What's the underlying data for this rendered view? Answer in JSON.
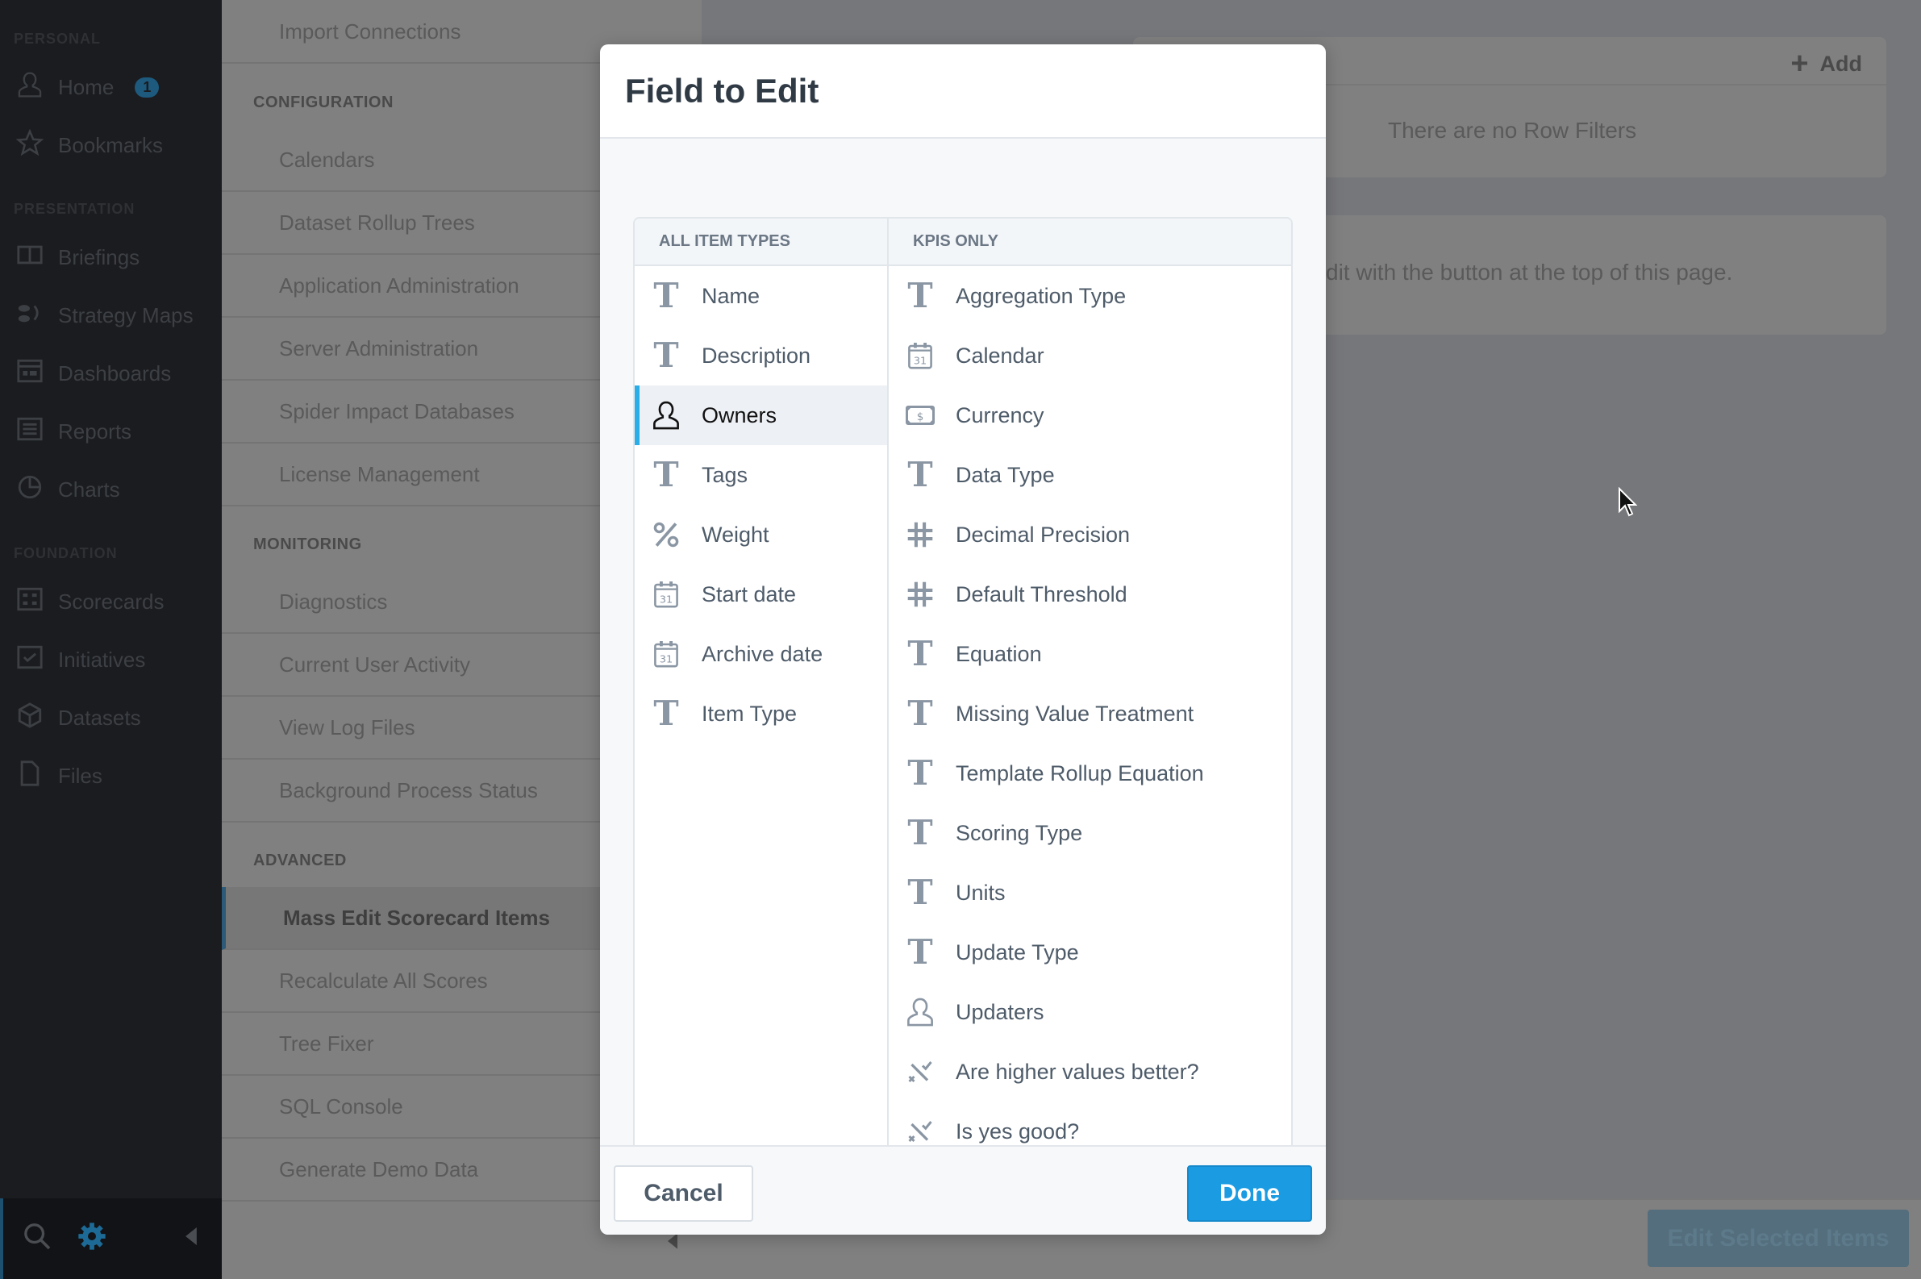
{
  "sidebar": {
    "sections": [
      {
        "label": "PERSONAL",
        "items": [
          {
            "label": "Home",
            "icon": "person-icon",
            "badge": "1"
          },
          {
            "label": "Bookmarks",
            "icon": "star-icon"
          }
        ]
      },
      {
        "label": "PRESENTATION",
        "items": [
          {
            "label": "Briefings",
            "icon": "book-icon"
          },
          {
            "label": "Strategy Maps",
            "icon": "strategy-map-icon"
          },
          {
            "label": "Dashboards",
            "icon": "dashboard-icon"
          },
          {
            "label": "Reports",
            "icon": "report-icon"
          },
          {
            "label": "Charts",
            "icon": "pie-chart-icon"
          }
        ]
      },
      {
        "label": "FOUNDATION",
        "items": [
          {
            "label": "Scorecards",
            "icon": "scorecard-icon"
          },
          {
            "label": "Initiatives",
            "icon": "checkbox-icon"
          },
          {
            "label": "Datasets",
            "icon": "cube-icon"
          },
          {
            "label": "Files",
            "icon": "file-icon"
          }
        ]
      }
    ],
    "accent": "#1d5a7e"
  },
  "nav": {
    "top_item": "Import Connections",
    "sections": [
      {
        "label": "CONFIGURATION",
        "items": [
          "Calendars",
          "Dataset Rollup Trees",
          "Application Administration",
          "Server Administration",
          "Spider Impact Databases",
          "License Management"
        ]
      },
      {
        "label": "MONITORING",
        "items": [
          "Diagnostics",
          "Current User Activity",
          "View Log Files",
          "Background Process Status"
        ]
      },
      {
        "label": "ADVANCED",
        "items": [
          "Mass Edit Scorecard Items",
          "Recalculate All Scores",
          "Tree Fixer",
          "SQL Console",
          "Generate Demo Data"
        ]
      }
    ],
    "active": "Mass Edit Scorecard Items"
  },
  "main": {
    "add_label": "Add",
    "row_filters_empty": "There are no Row Filters",
    "hint_text": "dit with the button at the top of this page.",
    "edit_selected_label": "Edit Selected Items"
  },
  "dialog": {
    "title": "Field to Edit",
    "left_header": "ALL ITEM TYPES",
    "right_header": "KPIS ONLY",
    "left_items": [
      {
        "label": "Name",
        "icon": "text-icon"
      },
      {
        "label": "Description",
        "icon": "text-icon"
      },
      {
        "label": "Owners",
        "icon": "person-icon",
        "selected": true
      },
      {
        "label": "Tags",
        "icon": "text-icon"
      },
      {
        "label": "Weight",
        "icon": "percent-icon"
      },
      {
        "label": "Start date",
        "icon": "calendar-icon"
      },
      {
        "label": "Archive date",
        "icon": "calendar-icon"
      },
      {
        "label": "Item Type",
        "icon": "text-icon"
      }
    ],
    "right_items": [
      {
        "label": "Aggregation Type",
        "icon": "text-icon"
      },
      {
        "label": "Calendar",
        "icon": "calendar-icon"
      },
      {
        "label": "Currency",
        "icon": "currency-icon"
      },
      {
        "label": "Data Type",
        "icon": "text-icon"
      },
      {
        "label": "Decimal Precision",
        "icon": "hash-icon"
      },
      {
        "label": "Default Threshold",
        "icon": "hash-icon"
      },
      {
        "label": "Equation",
        "icon": "text-icon"
      },
      {
        "label": "Missing Value Treatment",
        "icon": "text-icon"
      },
      {
        "label": "Template Rollup Equation",
        "icon": "text-icon"
      },
      {
        "label": "Scoring Type",
        "icon": "text-icon"
      },
      {
        "label": "Units",
        "icon": "text-icon"
      },
      {
        "label": "Update Type",
        "icon": "text-icon"
      },
      {
        "label": "Updaters",
        "icon": "person-icon"
      },
      {
        "label": "Are higher values better?",
        "icon": "boolean-icon"
      },
      {
        "label": "Is yes good?",
        "icon": "boolean-icon"
      }
    ],
    "cancel_label": "Cancel",
    "done_label": "Done",
    "done_color": "#1a9be2",
    "selected_accent": "#2aaee8"
  }
}
